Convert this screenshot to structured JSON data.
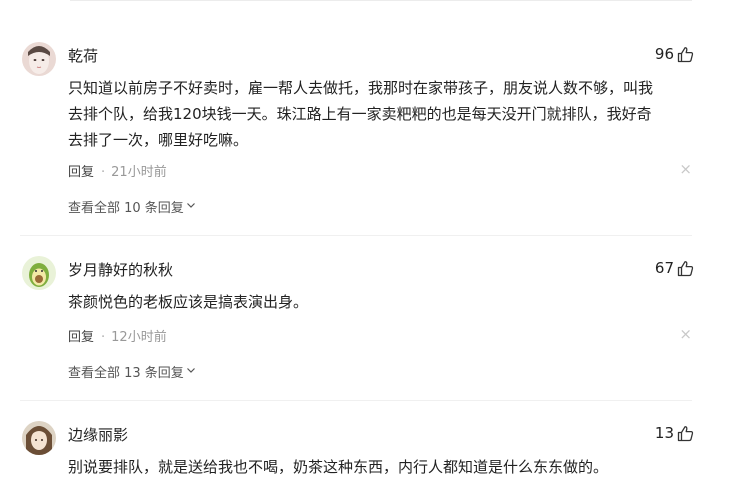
{
  "comments": [
    {
      "username": "乾荷",
      "likes": "96",
      "lines": [
        "只知道以前房子不好卖时，雇一帮人去做托，我那时在家带孩子，朋友说人数不够，叫我",
        "去排个队，给我120块钱一天。珠江路上有一家卖粑粑的也是每天没开门就排队，我好奇",
        "去排了一次，哪里好吃嘛。"
      ],
      "reply_label": "回复",
      "time": "21小时前",
      "close": "×",
      "view_replies": "查看全部 10 条回复"
    },
    {
      "username": "岁月静好的秋秋",
      "likes": "67",
      "lines": [
        "茶颜悦色的老板应该是搞表演出身。"
      ],
      "reply_label": "回复",
      "time": "12小时前",
      "close": "×",
      "view_replies": "查看全部 13 条回复"
    },
    {
      "username": "边缘丽影",
      "likes": "13",
      "lines": [
        "别说要排队，就是送给我也不喝，奶茶这种东西，内行人都知道是什么东东做的。"
      ]
    }
  ],
  "icons": {
    "like": "thumbs-up-icon",
    "chevron": "chevron-down-icon"
  }
}
